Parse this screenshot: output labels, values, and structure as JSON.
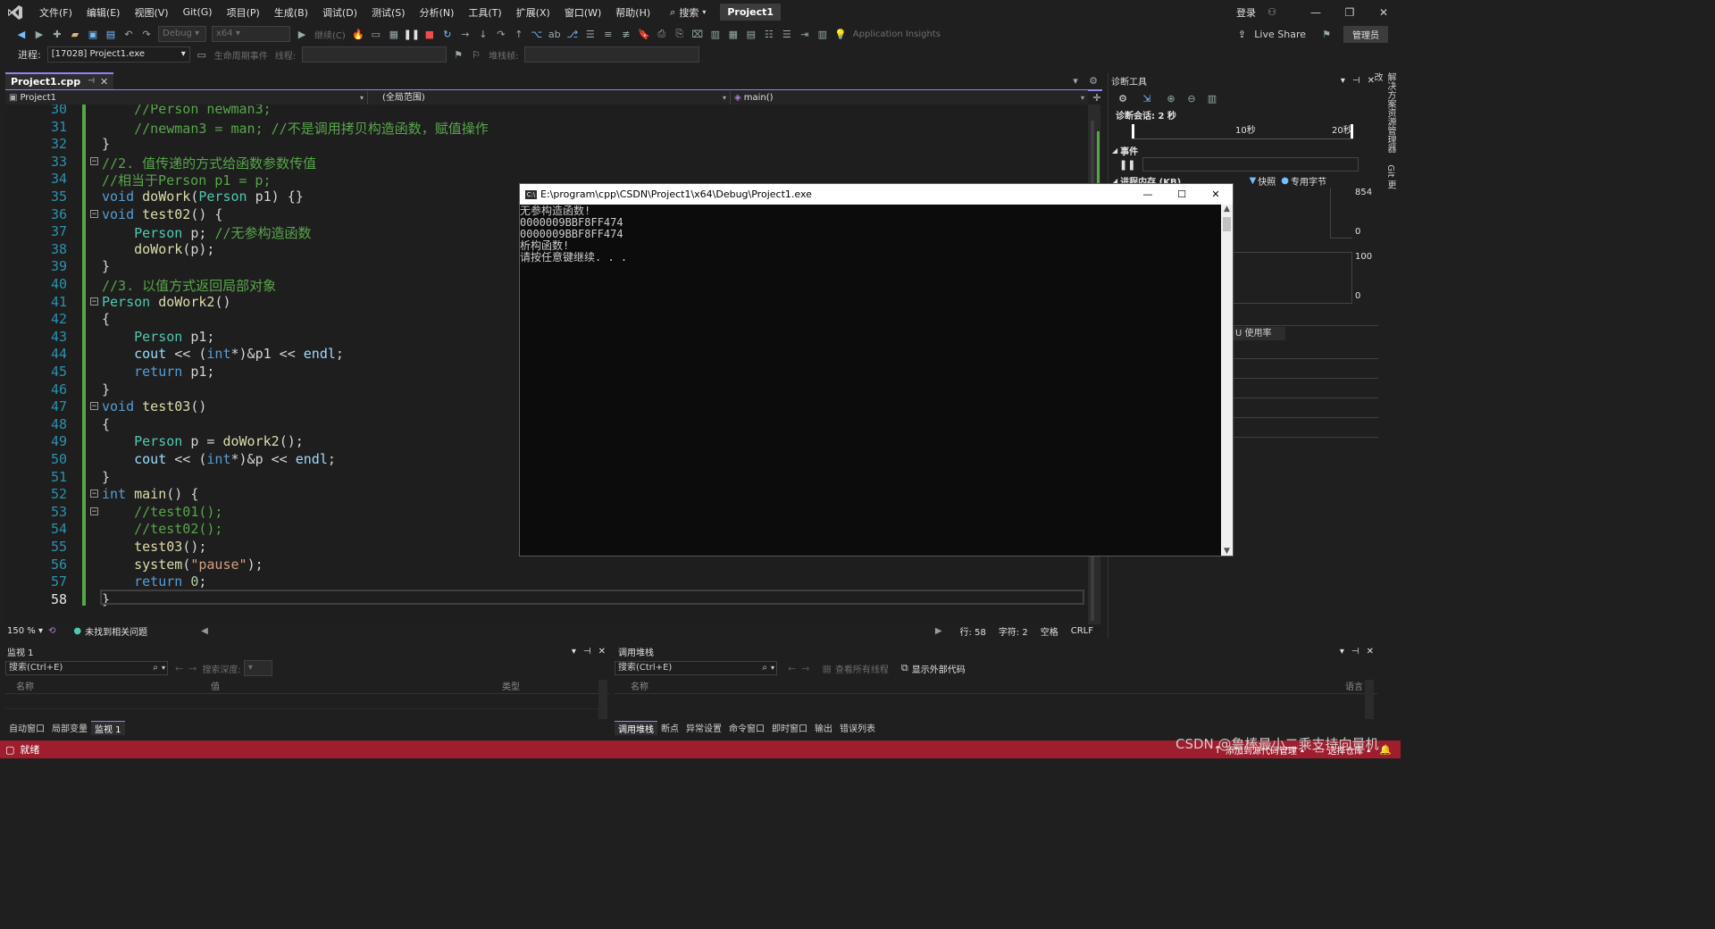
{
  "menu": {
    "items": [
      "文件(F)",
      "编辑(E)",
      "视图(V)",
      "Git(G)",
      "项目(P)",
      "生成(B)",
      "调试(D)",
      "测试(S)",
      "分析(N)",
      "工具(T)",
      "扩展(X)",
      "窗口(W)",
      "帮助(H)"
    ],
    "search_label": "搜索",
    "project_badge": "Project1",
    "login": "登录"
  },
  "toolbar": {
    "config": "Debug",
    "platform": "x64",
    "continue_label": "继续(C)",
    "app_insights": "Application Insights",
    "live_share": "Live Share",
    "admin": "管理员",
    "process_label": "进程:",
    "process_value": "[17028] Project1.exe",
    "lifecycle_label": "生命周期事件",
    "thread_label": "线程:",
    "stackframe_label": "堆栈帧:"
  },
  "editor": {
    "tab_label": "Project1.cpp",
    "nav_project": "Project1",
    "nav_scope": "(全局范围)",
    "nav_member": "main()",
    "lines": [
      {
        "n": "30",
        "t": "    //Person newman3;"
      },
      {
        "n": "31",
        "t": "    //newman3 = man; //不是调用拷贝构造函数，赋值操作"
      },
      {
        "n": "32",
        "t": "}"
      },
      {
        "n": "33",
        "t": "//2. 值传递的方式给函数参数传值"
      },
      {
        "n": "34",
        "t": "//相当于Person p1 = p;"
      },
      {
        "n": "35",
        "t": "void doWork(Person p1) {}"
      },
      {
        "n": "36",
        "t": "void test02() {"
      },
      {
        "n": "37",
        "t": "    Person p; //无参构造函数"
      },
      {
        "n": "38",
        "t": "    doWork(p);"
      },
      {
        "n": "39",
        "t": "}"
      },
      {
        "n": "40",
        "t": "//3. 以值方式返回局部对象"
      },
      {
        "n": "41",
        "t": "Person doWork2()"
      },
      {
        "n": "42",
        "t": "{"
      },
      {
        "n": "43",
        "t": "    Person p1;"
      },
      {
        "n": "44",
        "t": "    cout << (int*)&p1 << endl;"
      },
      {
        "n": "45",
        "t": "    return p1;"
      },
      {
        "n": "46",
        "t": "}"
      },
      {
        "n": "47",
        "t": "void test03()"
      },
      {
        "n": "48",
        "t": "{"
      },
      {
        "n": "49",
        "t": "    Person p = doWork2();"
      },
      {
        "n": "50",
        "t": "    cout << (int*)&p << endl;"
      },
      {
        "n": "51",
        "t": "}"
      },
      {
        "n": "52",
        "t": "int main() {"
      },
      {
        "n": "53",
        "t": "    //test01();"
      },
      {
        "n": "54",
        "t": "    //test02();"
      },
      {
        "n": "55",
        "t": "    test03();"
      },
      {
        "n": "56",
        "t": "    system(\"pause\");"
      },
      {
        "n": "57",
        "t": "    return 0;"
      },
      {
        "n": "58",
        "t": "}"
      }
    ],
    "status": {
      "zoom": "150 %",
      "issues": "未找到相关问题",
      "line": "行: 58",
      "col": "字符: 2",
      "spaces": "空格",
      "eol": "CRLF"
    }
  },
  "console": {
    "title": "E:\\program\\cpp\\CSDN\\Project1\\x64\\Debug\\Project1.exe",
    "output": [
      "无参构造函数!",
      "0000009BBF8FF474",
      "0000009BBF8FF474",
      "析构函数!",
      "请按任意键继续. . ."
    ]
  },
  "diagnostics": {
    "title": "诊断工具",
    "session": "诊断会话: 2 秒",
    "tick_10": "10秒",
    "tick_20": "20秒",
    "events": "事件",
    "memory": "进程内存 (KB)",
    "snapshot": "快照",
    "private_bytes": "专用字节",
    "mem_max": "854",
    "mem_min": "0",
    "cpu_max": "100",
    "cpu_min": "0",
    "cpu_tab": "U 使用率"
  },
  "side_tabs": [
    "解决方案资源管理器",
    "Git 更改"
  ],
  "watch_panel": {
    "title": "监视 1",
    "search": "搜索(Ctrl+E)",
    "depth_label": "搜索深度:",
    "col_name": "名称",
    "col_value": "值",
    "col_type": "类型",
    "tabs": [
      "自动窗口",
      "局部变量",
      "监视 1"
    ]
  },
  "callstack_panel": {
    "title": "调用堆栈",
    "search": "搜索(Ctrl+E)",
    "view_all_threads": "查看所有线程",
    "show_external": "显示外部代码",
    "col_name": "名称",
    "col_lang": "语言",
    "tabs": [
      "调用堆栈",
      "断点",
      "异常设置",
      "命令窗口",
      "即时窗口",
      "输出",
      "错误列表"
    ]
  },
  "statusbar": {
    "ready": "就绪",
    "add_source": "添加到源代码管理",
    "select_repo": "选择仓库",
    "watermark": "CSDN @鲁棒最小二乘支持向量机"
  }
}
